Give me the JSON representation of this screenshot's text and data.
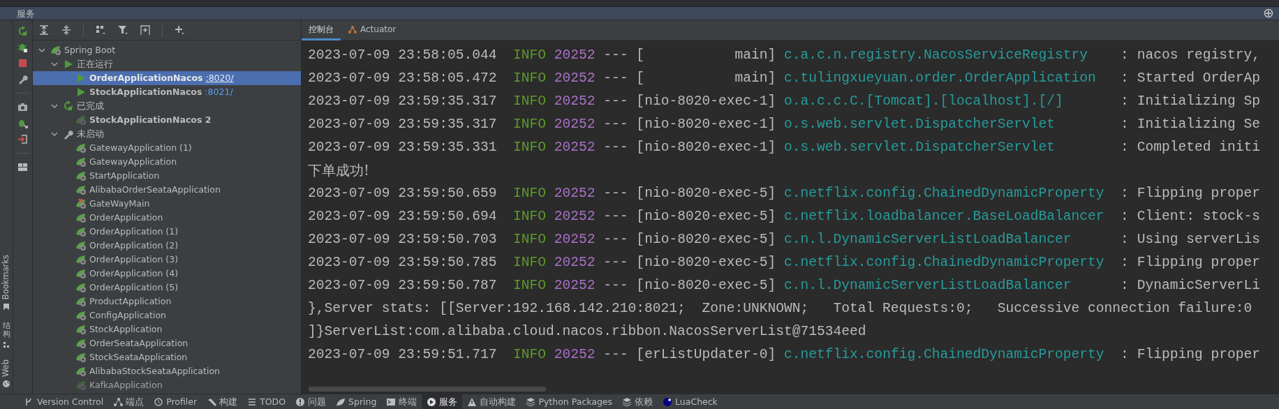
{
  "panel_title": "服务",
  "side_labels": [
    {
      "label": "Bookmarks",
      "kind": "latin"
    },
    {
      "label": "结构",
      "kind": "cjk"
    },
    {
      "label": "Web",
      "kind": "latin"
    }
  ],
  "tree": [
    {
      "label": "Spring Boot",
      "kind": "root",
      "expanded": true,
      "selected": false,
      "children": [
        {
          "label": "正在运行",
          "kind": "running-group",
          "expanded": true,
          "selected": false,
          "children": [
            {
              "label": "OrderApplicationNacos",
              "port": ":8020/",
              "kind": "running",
              "selected": true
            },
            {
              "label": "StockApplicationNacos",
              "port": ":8021/",
              "kind": "running",
              "selected": false
            }
          ]
        },
        {
          "label": "已完成",
          "kind": "finished-group",
          "expanded": true,
          "selected": false,
          "children": [
            {
              "label": "StockApplicationNacos 2",
              "kind": "finished",
              "selected": false
            }
          ]
        },
        {
          "label": "未启动",
          "kind": "idle-group",
          "expanded": true,
          "selected": false,
          "children": [
            {
              "label": "GatewayApplication (1)",
              "kind": "config",
              "selected": false
            },
            {
              "label": "GatewayApplication",
              "kind": "config",
              "selected": false
            },
            {
              "label": "StartApplication",
              "kind": "config",
              "selected": false
            },
            {
              "label": "AlibabaOrderSeataApplication",
              "kind": "config",
              "selected": false
            },
            {
              "label": "GateWayMain",
              "kind": "config-error",
              "selected": false
            },
            {
              "label": "OrderApplication",
              "kind": "config",
              "selected": false
            },
            {
              "label": "OrderApplication (1)",
              "kind": "config",
              "selected": false
            },
            {
              "label": "OrderApplication (2)",
              "kind": "config",
              "selected": false
            },
            {
              "label": "OrderApplication (3)",
              "kind": "config",
              "selected": false
            },
            {
              "label": "OrderApplication (4)",
              "kind": "config",
              "selected": false
            },
            {
              "label": "OrderApplication (5)",
              "kind": "config",
              "selected": false
            },
            {
              "label": "ProductApplication",
              "kind": "config",
              "selected": false
            },
            {
              "label": "ConfigApplication",
              "kind": "config",
              "selected": false
            },
            {
              "label": "StockApplication",
              "kind": "config",
              "selected": false
            },
            {
              "label": "OrderSeataApplication",
              "kind": "config",
              "selected": false
            },
            {
              "label": "StockSeataApplication",
              "kind": "config",
              "selected": false
            },
            {
              "label": "AlibabaStockSeataApplication",
              "kind": "config",
              "selected": false
            },
            {
              "label": "KafkaApplication",
              "kind": "config-unavailable",
              "selected": false
            }
          ]
        }
      ]
    }
  ],
  "console_tabs": [
    {
      "label": "控制台",
      "selected": true
    },
    {
      "label": "Actuator",
      "selected": false
    }
  ],
  "console_lines": [
    {
      "kind": "log",
      "time": "2023-07-09 23:58:05.044",
      "level": "INFO",
      "pid": "20252",
      "separator": "---",
      "thread": "[           main]",
      "logger": "c.a.c.n.registry.NacosServiceRegistry",
      "message": ": nacos registry,"
    },
    {
      "kind": "log",
      "time": "2023-07-09 23:58:05.472",
      "level": "INFO",
      "pid": "20252",
      "separator": "---",
      "thread": "[           main]",
      "logger": "c.tulingxueyuan.order.OrderApplication",
      "message": ": Started OrderAp"
    },
    {
      "kind": "log",
      "time": "2023-07-09 23:59:35.317",
      "level": "INFO",
      "pid": "20252",
      "separator": "---",
      "thread": "[nio-8020-exec-1]",
      "logger": "o.a.c.c.C.[Tomcat].[localhost].[/]",
      "message": ": Initializing Sp"
    },
    {
      "kind": "log",
      "time": "2023-07-09 23:59:35.317",
      "level": "INFO",
      "pid": "20252",
      "separator": "---",
      "thread": "[nio-8020-exec-1]",
      "logger": "o.s.web.servlet.DispatcherServlet",
      "message": ": Initializing Se"
    },
    {
      "kind": "log",
      "time": "2023-07-09 23:59:35.331",
      "level": "INFO",
      "pid": "20252",
      "separator": "---",
      "thread": "[nio-8020-exec-1]",
      "logger": "o.s.web.servlet.DispatcherServlet",
      "message": ": Completed initi"
    },
    {
      "kind": "text",
      "text": "下单成功!"
    },
    {
      "kind": "log",
      "time": "2023-07-09 23:59:50.659",
      "level": "INFO",
      "pid": "20252",
      "separator": "---",
      "thread": "[nio-8020-exec-5]",
      "logger": "c.netflix.config.ChainedDynamicProperty",
      "message": ": Flipping proper"
    },
    {
      "kind": "log",
      "time": "2023-07-09 23:59:50.694",
      "level": "INFO",
      "pid": "20252",
      "separator": "---",
      "thread": "[nio-8020-exec-5]",
      "logger": "c.netflix.loadbalancer.BaseLoadBalancer",
      "message": ": Client: stock-s"
    },
    {
      "kind": "log",
      "time": "2023-07-09 23:59:50.703",
      "level": "INFO",
      "pid": "20252",
      "separator": "---",
      "thread": "[nio-8020-exec-5]",
      "logger": "c.n.l.DynamicServerListLoadBalancer",
      "message": ": Using serverLis"
    },
    {
      "kind": "log",
      "time": "2023-07-09 23:59:50.785",
      "level": "INFO",
      "pid": "20252",
      "separator": "---",
      "thread": "[nio-8020-exec-5]",
      "logger": "c.netflix.config.ChainedDynamicProperty",
      "message": ": Flipping proper"
    },
    {
      "kind": "log",
      "time": "2023-07-09 23:59:50.787",
      "level": "INFO",
      "pid": "20252",
      "separator": "---",
      "thread": "[nio-8020-exec-5]",
      "logger": "c.n.l.DynamicServerListLoadBalancer",
      "message": ": DynamicServerLi"
    },
    {
      "kind": "text",
      "text": "},Server stats: [[Server:192.168.142.210:8021;  Zone:UNKNOWN;   Total Requests:0;   Successive connection failure:0"
    },
    {
      "kind": "text",
      "text": "]}ServerList:com.alibaba.cloud.nacos.ribbon.NacosServerList@71534eed"
    },
    {
      "kind": "log",
      "time": "2023-07-09 23:59:51.717",
      "level": "INFO",
      "pid": "20252",
      "separator": "---",
      "thread": "[erListUpdater-0]",
      "logger": "c.netflix.config.ChainedDynamicProperty",
      "message": ": Flipping proper"
    }
  ],
  "bottom_tabs": [
    {
      "label": "Version Control",
      "selected": false
    },
    {
      "label": "端点",
      "selected": false
    },
    {
      "label": "Profiler",
      "selected": false
    },
    {
      "label": "构建",
      "selected": false
    },
    {
      "label": "TODO",
      "selected": false
    },
    {
      "label": "问题",
      "selected": false
    },
    {
      "label": "Spring",
      "selected": false
    },
    {
      "label": "终端",
      "selected": false
    },
    {
      "label": "服务",
      "selected": true
    },
    {
      "label": "自动构建",
      "selected": false
    },
    {
      "label": "Python Packages",
      "selected": false
    },
    {
      "label": "依赖",
      "selected": false
    },
    {
      "label": "LuaCheck",
      "selected": false
    }
  ]
}
